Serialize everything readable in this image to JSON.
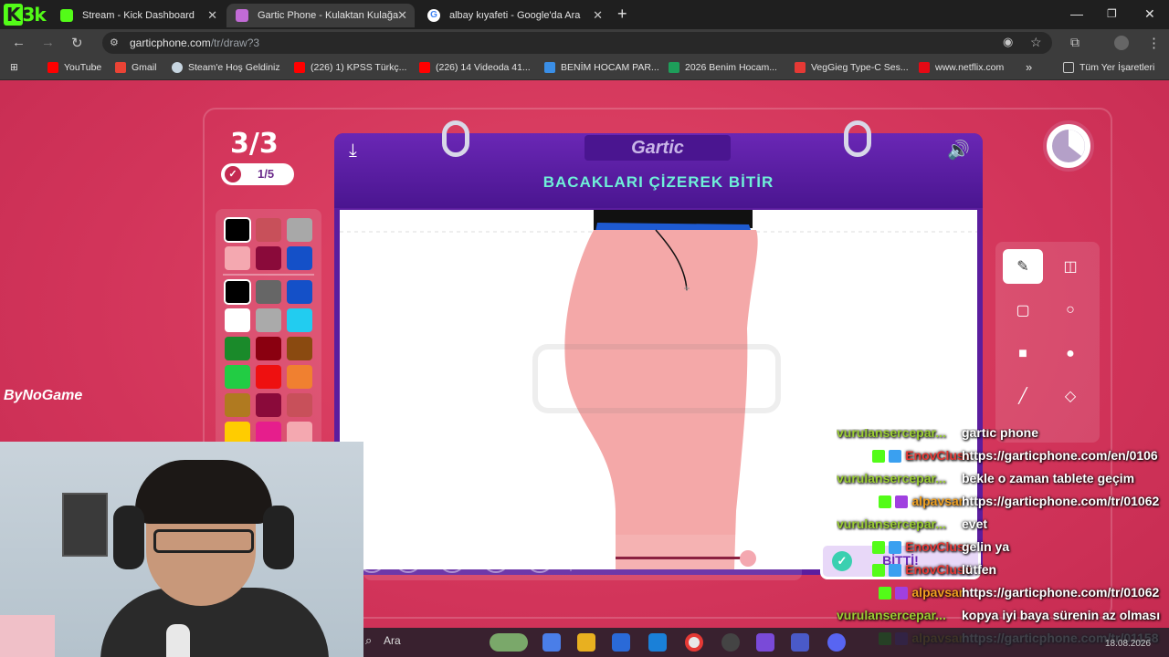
{
  "browser": {
    "logo_text": "3k",
    "tabs": [
      {
        "title": "Stream - Kick Dashboard",
        "favicon_color": "#53fc18"
      },
      {
        "title": "Gartic Phone - Kulaktan Kulağa",
        "favicon_color": "#c26bd6"
      },
      {
        "title": "albay kıyafeti - Google'da Ara",
        "favicon_color": "#4285f4"
      }
    ],
    "new_tab_icon": "plus-icon",
    "url_host": "garticphone.com",
    "url_path": "/tr/draw?3",
    "bookmarks": [
      {
        "label": "YouTube",
        "color": "#ff0000"
      },
      {
        "label": "Gmail",
        "color": "#ea4335"
      },
      {
        "label": "Steam'e Hoş Geldiniz",
        "color": "#c7d5e0"
      },
      {
        "label": "(226) 1) KPSS Türkç...",
        "color": "#ff0000"
      },
      {
        "label": "(226) 14 Videoda 41...",
        "color": "#ff0000"
      },
      {
        "label": "BENİM HOCAM PAR...",
        "color": "#3a8ee6"
      },
      {
        "label": "2026 Benim Hocam...",
        "color": "#1e9e5a"
      },
      {
        "label": "VegGieg Type-C Ses...",
        "color": "#e53935"
      },
      {
        "label": "www.netflix.com",
        "color": "#e50914"
      }
    ],
    "bookmarks_more": "»",
    "all_bookmarks": "Tüm Yer İşaretleri"
  },
  "overlay": {
    "watermark": "ByNoGame"
  },
  "game": {
    "round": "3/3",
    "votes": "1/5",
    "brand": "Gartic",
    "instruction": "BACAKLARI ÇİZEREK BİTİR",
    "done_label": "BİTTİ!",
    "palette": [
      "#000000",
      "#c8505a",
      "#a8a8a8",
      "#f4a8b0",
      "#8a0a3a",
      "#1450c8",
      "#000000",
      "#666666",
      "#1450c8",
      "#ffffff",
      "#aaaaaa",
      "#22ccf0",
      "#1a8a2a",
      "#8a0010",
      "#8a4a10",
      "#22cc44",
      "#ee1010",
      "#f08030",
      "#b07a20",
      "#8a0a3a",
      "#c8505a",
      "#ffcc00",
      "#e61e8c",
      "#f4a8b0"
    ]
  },
  "chat": [
    {
      "user": "vurulansercepar...",
      "user_color": "#9acd32",
      "message": "gartic phone",
      "badges": []
    },
    {
      "user": "EnovCluse",
      "user_color": "#e53935",
      "message": "https://garticphone.com/en/0106",
      "badges": [
        "#53fc18",
        "#3aa0f0"
      ]
    },
    {
      "user": "vurulansercepar...",
      "user_color": "#9acd32",
      "message": "bekle o zaman tablete geçim",
      "badges": []
    },
    {
      "user": "alpavsar",
      "user_color": "#f0a020",
      "message": "https://garticphone.com/tr/01062",
      "badges": [
        "#53fc18",
        "#a040e0"
      ]
    },
    {
      "user": "vurulansercepar...",
      "user_color": "#9acd32",
      "message": "evet",
      "badges": []
    },
    {
      "user": "EnovCluse",
      "user_color": "#e53935",
      "message": "gelin ya",
      "badges": [
        "#53fc18",
        "#3aa0f0"
      ]
    },
    {
      "user": "EnovCluse",
      "user_color": "#e53935",
      "message": "lütfen",
      "badges": [
        "#53fc18",
        "#3aa0f0"
      ]
    },
    {
      "user": "alpavsar",
      "user_color": "#f0a020",
      "message": "https://garticphone.com/tr/01062",
      "badges": [
        "#53fc18",
        "#a040e0"
      ]
    },
    {
      "user": "vurulansercepar...",
      "user_color": "#9acd32",
      "message": "kopya iyi baya sürenin az olması",
      "badges": []
    },
    {
      "user": "alpavsar",
      "user_color": "#f0a020",
      "message": "https://garticphone.com/tr/01158",
      "badges": [
        "#53fc18",
        "#a040e0"
      ]
    }
  ],
  "taskbar": {
    "search_placeholder": "Ara",
    "date": "18.08.2026"
  }
}
